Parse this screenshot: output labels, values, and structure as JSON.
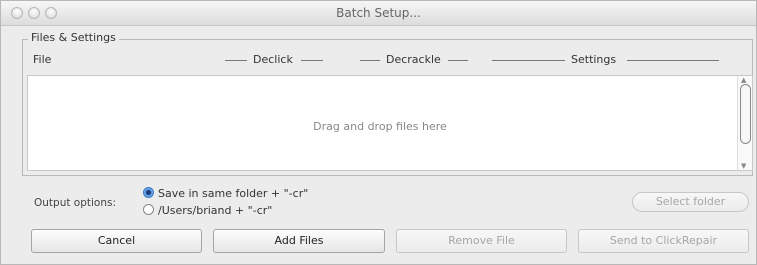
{
  "window": {
    "title": "Batch Setup..."
  },
  "files_settings": {
    "group_label": "Files & Settings",
    "columns": {
      "file": "File",
      "declick": "Declick",
      "decrackle": "Decrackle",
      "settings": "Settings"
    },
    "drop_hint": "Drag and drop files here"
  },
  "output": {
    "label": "Output options:",
    "options": [
      {
        "label": "Save in same folder + \"-cr\"",
        "selected": true
      },
      {
        "label": "/Users/briand + \"-cr\"",
        "selected": false
      }
    ],
    "select_folder_label": "Select folder"
  },
  "buttons": {
    "cancel": "Cancel",
    "add_files": "Add Files",
    "remove_file": "Remove File",
    "send": "Send to ClickRepair"
  },
  "colors": {
    "accent": "#3a78c4"
  }
}
